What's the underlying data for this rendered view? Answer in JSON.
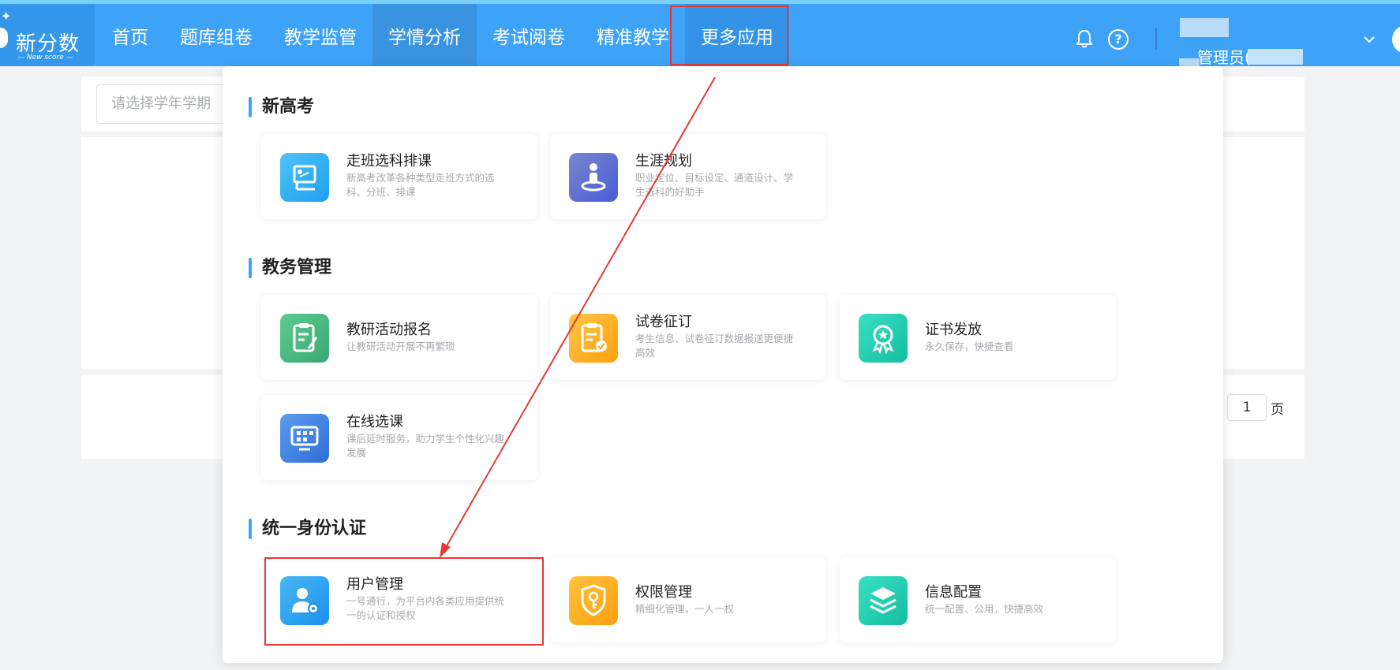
{
  "logo": {
    "text": "新分数",
    "sub": "— New score —"
  },
  "nav": [
    "首页",
    "题库组卷",
    "教学监管",
    "学情分析",
    "考试阅卷",
    "精准教学",
    "更多应用"
  ],
  "header": {
    "help": "?",
    "user": "管理员("
  },
  "page": {
    "term_placeholder": "请选择学年学期",
    "page_number": "1",
    "page_unit": "页"
  },
  "sections": [
    {
      "title": "新高考",
      "cards": [
        {
          "title": "走班选科排课",
          "desc": "新高考改革各种类型走班方式的选科、分班、排课",
          "icon": "classroom-schedule-icon",
          "color": "#29b6f6"
        },
        {
          "title": "生涯规划",
          "desc": "职业定位、目标设定、通道设计、学生选科的好助手",
          "icon": "career-planning-icon",
          "color": "#5c6bc0"
        }
      ]
    },
    {
      "title": "教务管理",
      "cards": [
        {
          "title": "教研活动报名",
          "desc": "让教研活动开展不再繁琐",
          "icon": "activity-signup-icon",
          "color": "#43b57e"
        },
        {
          "title": "试卷征订",
          "desc": "考生信息、试卷征订数据报送更便捷高效",
          "icon": "paper-order-icon",
          "color": "#ffb020"
        },
        {
          "title": "证书发放",
          "desc": "永久保存，快捷查看",
          "icon": "certificate-icon",
          "color": "#1fcfb0"
        },
        {
          "title": "在线选课",
          "desc": "课后延时服务，助力学生个性化兴趣发展",
          "icon": "online-course-icon",
          "color": "#3d7ee6"
        }
      ]
    },
    {
      "title": "统一身份认证",
      "cards": [
        {
          "title": "用户管理",
          "desc": "一号通行，为平台内各类应用提供统一的认证和授权",
          "icon": "user-management-icon",
          "color": "#2aa6f0"
        },
        {
          "title": "权限管理",
          "desc": "精细化管理，一人一权",
          "icon": "permission-key-icon",
          "color": "#ffae1a"
        },
        {
          "title": "信息配置",
          "desc": "统一配置、公用，快捷高效",
          "icon": "info-config-icon",
          "color": "#1fcfb0"
        }
      ]
    }
  ]
}
